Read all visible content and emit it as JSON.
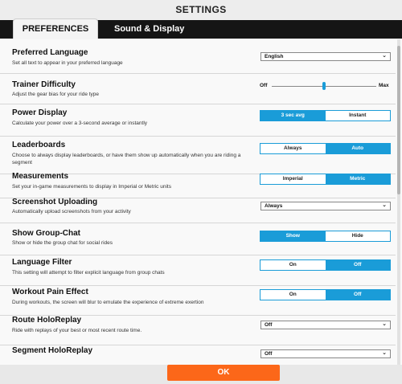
{
  "window": {
    "title": "SETTINGS"
  },
  "tabs": [
    {
      "label": "PREFERENCES",
      "active": true
    },
    {
      "label": "Sound & Display",
      "active": false
    }
  ],
  "settings": {
    "preferred_language": {
      "label": "Preferred Language",
      "description": "Set all text to appear in your preferred language",
      "value": "English"
    },
    "trainer_difficulty": {
      "label": "Trainer Difficulty",
      "description": "Adjust the gear bias for your ride type",
      "min_label": "Off",
      "max_label": "Max",
      "level": 0.5
    },
    "power_display": {
      "label": "Power Display",
      "description": "Calculate your power over a 3-second average or instantly",
      "options": [
        "3 sec avg",
        "Instant"
      ],
      "selected": "3 sec avg"
    },
    "leaderboards": {
      "label": "Leaderboards",
      "description": "Choose to always display leaderboards, or have them show up automatically when you are riding a segment",
      "options": [
        "Always",
        "Auto"
      ],
      "selected": "Auto"
    },
    "measurements": {
      "label": "Measurements",
      "description": "Set your in-game measurements to display in Imperial or Metric units",
      "options": [
        "Imperial",
        "Metric"
      ],
      "selected": "Metric"
    },
    "screenshot_uploading": {
      "label": "Screenshot Uploading",
      "description": "Automatically upload screenshots from your activity",
      "value": "Always"
    },
    "show_group_chat": {
      "label": "Show Group-Chat",
      "description": "Show or hide the group chat for social rides",
      "options": [
        "Show",
        "Hide"
      ],
      "selected": "Show"
    },
    "language_filter": {
      "label": "Language Filter",
      "description": "This setting will attempt to filter explicit language from group chats",
      "options": [
        "On",
        "Off"
      ],
      "selected": "Off"
    },
    "workout_pain_effect": {
      "label": "Workout Pain Effect",
      "description": "During workouts, the screen will blur to emulate the experience of extreme exertion",
      "options": [
        "On",
        "Off"
      ],
      "selected": "Off"
    },
    "route_holoreplay": {
      "label": "Route HoloReplay",
      "description": "Ride with replays of your best or most recent route time.",
      "value": "Off"
    },
    "segment_holoreplay": {
      "label": "Segment HoloReplay",
      "value": "Off"
    }
  },
  "footer": {
    "ok_label": "OK"
  },
  "colors": {
    "accent": "#1a9cd8",
    "ok_button": "#fc6719",
    "tab_bar": "#151515"
  }
}
